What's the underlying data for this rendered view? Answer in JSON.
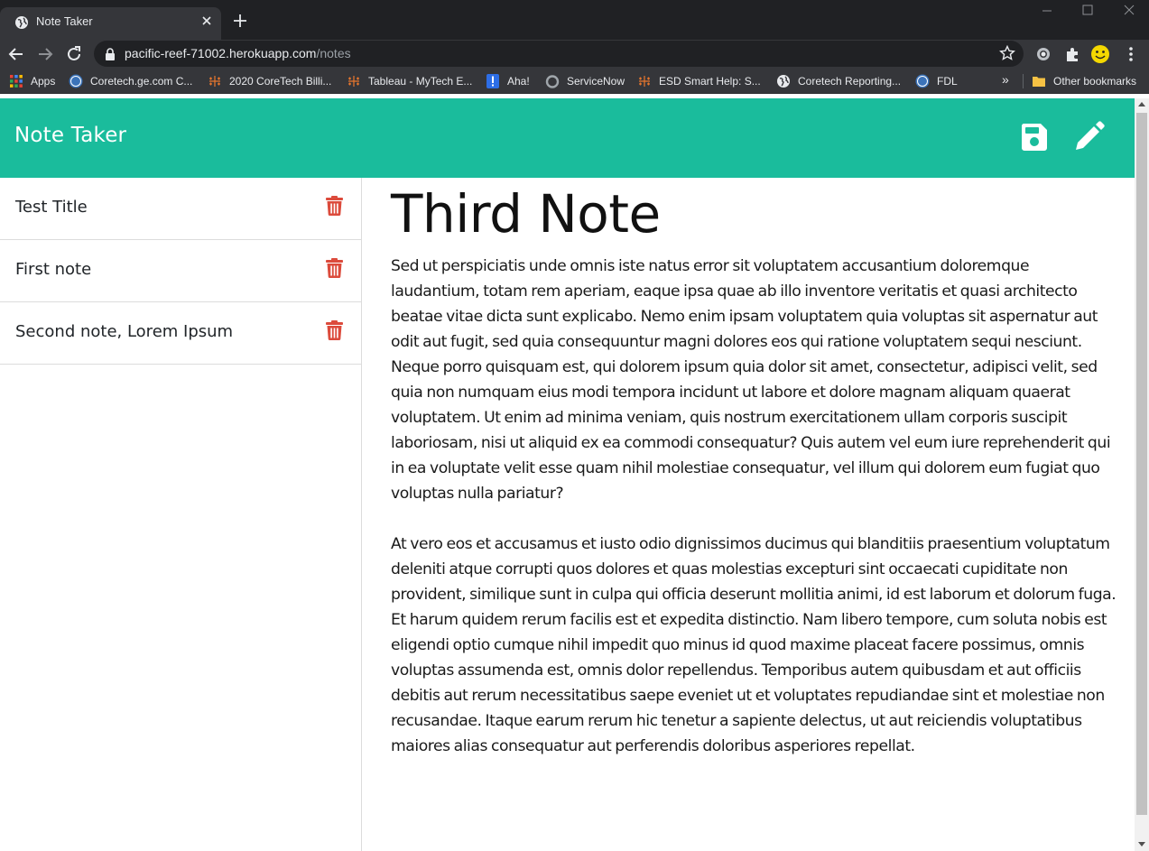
{
  "browser": {
    "tab": {
      "title": "Note Taker",
      "favicon": "globe-icon"
    },
    "url": {
      "host": "pacific-reef-71002.herokuapp.com",
      "path": "/notes"
    },
    "bookmarks": [
      {
        "label": "Apps",
        "icon": "apps-grid-icon"
      },
      {
        "label": "Coretech.ge.com C...",
        "icon": "ge-logo-icon"
      },
      {
        "label": "2020 CoreTech Billi...",
        "icon": "tableau-icon"
      },
      {
        "label": "Tableau - MyTech E...",
        "icon": "tableau-icon"
      },
      {
        "label": "Aha!",
        "icon": "aha-icon"
      },
      {
        "label": "ServiceNow",
        "icon": "servicenow-icon"
      },
      {
        "label": "ESD Smart Help: S...",
        "icon": "tableau-icon"
      },
      {
        "label": "Coretech Reporting...",
        "icon": "globe-icon"
      },
      {
        "label": "FDL",
        "icon": "ge-logo-icon"
      }
    ],
    "bookmarks_more": "»",
    "other_bookmarks": "Other bookmarks"
  },
  "app": {
    "title": "Note Taker",
    "colors": {
      "navbar": "#1abc9c",
      "trash": "#dc4b3c"
    },
    "notes": [
      {
        "title": "Test Title"
      },
      {
        "title": "First note"
      },
      {
        "title": "Second note, Lorem Ipsum"
      }
    ],
    "active_note": {
      "title": "Third Note",
      "text": "Sed ut perspiciatis unde omnis iste natus error sit voluptatem accusantium doloremque laudantium, totam rem aperiam, eaque ipsa quae ab illo inventore veritatis et quasi architecto beatae vitae dicta sunt explicabo. Nemo enim ipsam voluptatem quia voluptas sit aspernatur aut odit aut fugit, sed quia consequuntur magni dolores eos qui ratione voluptatem sequi nesciunt. Neque porro quisquam est, qui dolorem ipsum quia dolor sit amet, consectetur, adipisci velit, sed quia non numquam eius modi tempora incidunt ut labore et dolore magnam aliquam quaerat voluptatem. Ut enim ad minima veniam, quis nostrum exercitationem ullam corporis suscipit laboriosam, nisi ut aliquid ex ea commodi consequatur? Quis autem vel eum iure reprehenderit qui in ea voluptate velit esse quam nihil molestiae consequatur, vel illum qui dolorem eum fugiat quo voluptas nulla pariatur?\n\nAt vero eos et accusamus et iusto odio dignissimos ducimus qui blanditiis praesentium voluptatum deleniti atque corrupti quos dolores et quas molestias excepturi sint occaecati cupiditate non provident, similique sunt in culpa qui officia deserunt mollitia animi, id est laborum et dolorum fuga. Et harum quidem rerum facilis est et expedita distinctio. Nam libero tempore, cum soluta nobis est eligendi optio cumque nihil impedit quo minus id quod maxime placeat facere possimus, omnis voluptas assumenda est, omnis dolor repellendus. Temporibus autem quibusdam et aut officiis debitis aut rerum necessitatibus saepe eveniet ut et voluptates repudiandae sint et molestiae non recusandae. Itaque earum rerum hic tenetur a sapiente delectus, ut aut reiciendis voluptatibus maiores alias consequatur aut perferendis doloribus asperiores repellat."
    }
  }
}
